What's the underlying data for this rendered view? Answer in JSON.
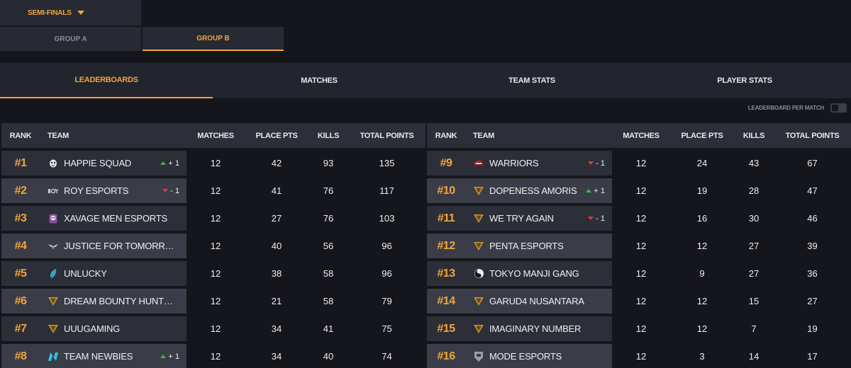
{
  "stage": {
    "label": "SEMI-FINALS"
  },
  "groups": [
    {
      "label": "GROUP A",
      "active": false
    },
    {
      "label": "GROUP B",
      "active": true
    }
  ],
  "tabs": [
    {
      "label": "LEADERBOARDS",
      "active": true
    },
    {
      "label": "MATCHES",
      "active": false
    },
    {
      "label": "TEAM STATS",
      "active": false
    },
    {
      "label": "PLAYER STATS",
      "active": false
    }
  ],
  "per_match": {
    "label": "LEADERBOARD PER MATCH",
    "on": false
  },
  "columns": {
    "rank": "RANK",
    "team": "TEAM",
    "matches": "MATCHES",
    "place": "PLACE PTS",
    "kills": "KILLS",
    "total": "TOTAL POINTS"
  },
  "colors": {
    "accent": "#f2a53a",
    "up": "#39b54a",
    "down": "#e23a3a"
  },
  "rows": [
    {
      "rank": "#1",
      "team": "HAPPIE SQUAD",
      "logo": "mask-icon",
      "change": "+ 1",
      "dir": "up",
      "matches": "12",
      "place": "42",
      "kills": "93",
      "total": "135"
    },
    {
      "rank": "#2",
      "team": "ROY ESPORTS",
      "logo": "roy-icon",
      "change": "- 1",
      "dir": "down",
      "matches": "12",
      "place": "41",
      "kills": "76",
      "total": "117"
    },
    {
      "rank": "#3",
      "team": "XAVAGE MEN ESPORTS",
      "logo": "skull-icon",
      "change": "",
      "dir": "",
      "matches": "12",
      "place": "27",
      "kills": "76",
      "total": "103"
    },
    {
      "rank": "#4",
      "team": "JUSTICE FOR TOMORROW E...",
      "logo": "wings-icon",
      "change": "",
      "dir": "",
      "matches": "12",
      "place": "40",
      "kills": "56",
      "total": "96"
    },
    {
      "rank": "#5",
      "team": "UNLUCKY",
      "logo": "feather-icon",
      "change": "",
      "dir": "",
      "matches": "12",
      "place": "38",
      "kills": "58",
      "total": "96"
    },
    {
      "rank": "#6",
      "team": "DREAM BOUNTY HUNTER G...",
      "logo": "shield-icon",
      "change": "",
      "dir": "",
      "matches": "12",
      "place": "21",
      "kills": "58",
      "total": "79"
    },
    {
      "rank": "#7",
      "team": "UUUGAMING",
      "logo": "shield-icon",
      "change": "",
      "dir": "",
      "matches": "12",
      "place": "34",
      "kills": "41",
      "total": "75"
    },
    {
      "rank": "#8",
      "team": "TEAM NEWBIES",
      "logo": "n-bolt-icon",
      "change": "+ 1",
      "dir": "up",
      "matches": "12",
      "place": "34",
      "kills": "40",
      "total": "74"
    },
    {
      "rank": "#9",
      "team": "WARRIORS",
      "logo": "helmet-icon",
      "change": "- 1",
      "dir": "down",
      "matches": "12",
      "place": "24",
      "kills": "43",
      "total": "67"
    },
    {
      "rank": "#10",
      "team": "DOPENESS AMORIS",
      "logo": "shield-icon",
      "change": "+ 1",
      "dir": "up",
      "matches": "12",
      "place": "19",
      "kills": "28",
      "total": "47"
    },
    {
      "rank": "#11",
      "team": "WE TRY AGAIN",
      "logo": "shield-icon",
      "change": "- 1",
      "dir": "down",
      "matches": "12",
      "place": "16",
      "kills": "30",
      "total": "46"
    },
    {
      "rank": "#12",
      "team": "PENTA ESPORTS",
      "logo": "shield-icon",
      "change": "",
      "dir": "",
      "matches": "12",
      "place": "12",
      "kills": "27",
      "total": "39"
    },
    {
      "rank": "#13",
      "team": "TOKYO MANJI GANG",
      "logo": "yin-yang-icon",
      "change": "",
      "dir": "",
      "matches": "12",
      "place": "9",
      "kills": "27",
      "total": "36"
    },
    {
      "rank": "#14",
      "team": "GARUD4 NUSANTARA",
      "logo": "shield-icon",
      "change": "",
      "dir": "",
      "matches": "12",
      "place": "12",
      "kills": "15",
      "total": "27"
    },
    {
      "rank": "#15",
      "team": "IMAGINARY NUMBER",
      "logo": "shield-icon",
      "change": "",
      "dir": "",
      "matches": "12",
      "place": "12",
      "kills": "7",
      "total": "19"
    },
    {
      "rank": "#16",
      "team": "MODE ESPORTS",
      "logo": "crest-icon",
      "change": "",
      "dir": "",
      "matches": "12",
      "place": "3",
      "kills": "14",
      "total": "17"
    }
  ]
}
